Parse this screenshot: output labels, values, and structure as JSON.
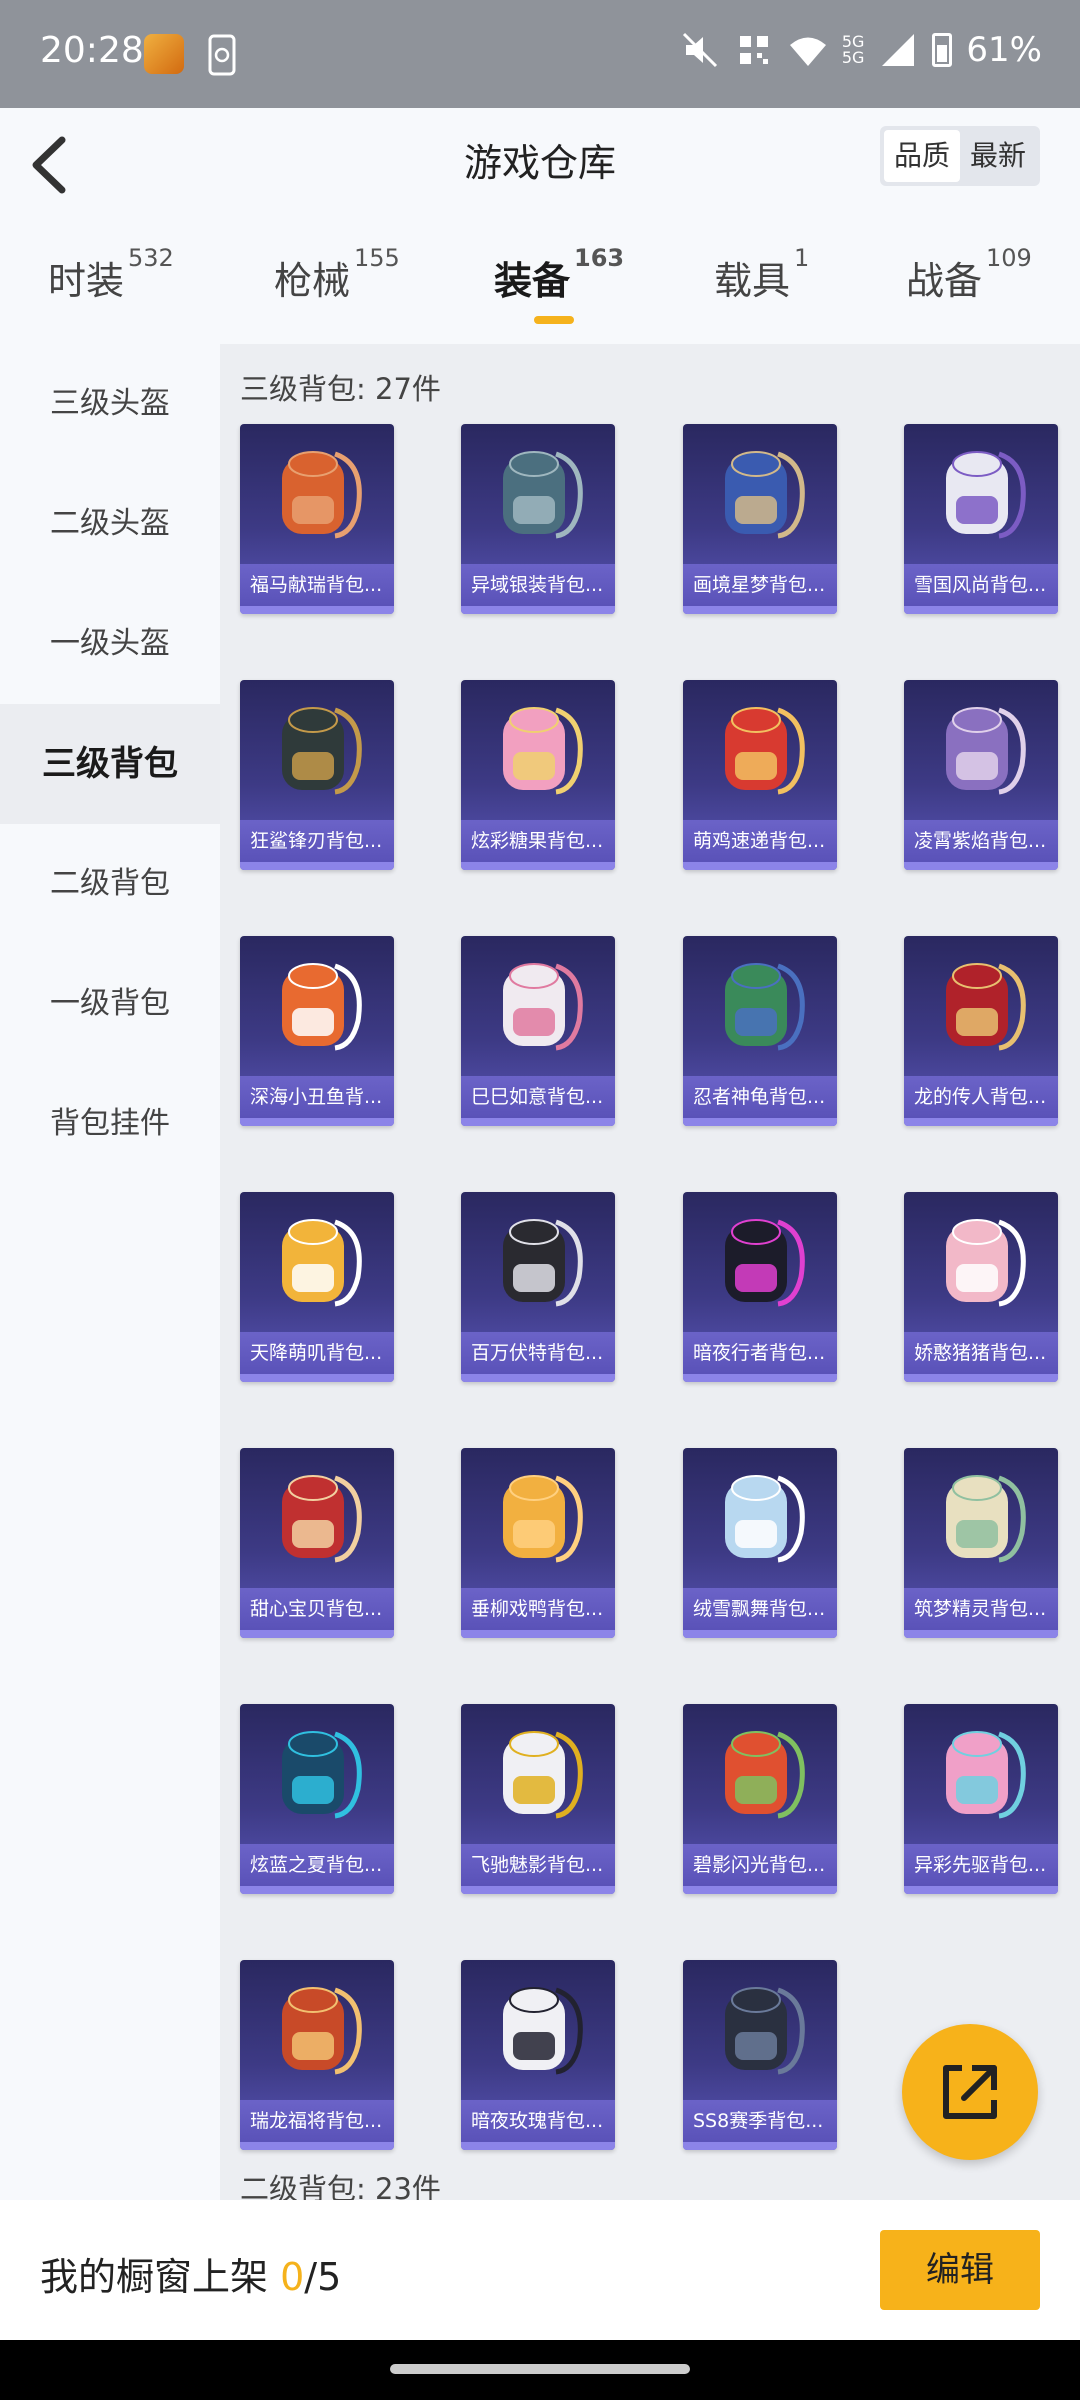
{
  "status_bar": {
    "time": "20:28",
    "battery": "61%",
    "icons": [
      "app-notification-icon",
      "phone-sync-icon",
      "mute-icon",
      "nfc-icon",
      "wifi-icon",
      "signal-5g-icon",
      "battery-icon"
    ],
    "network_label_1": "5G",
    "network_label_2": "5G"
  },
  "header": {
    "title": "游戏仓库",
    "sort_options": [
      "品质",
      "最新"
    ],
    "sort_selected": "品质"
  },
  "tabs": [
    {
      "label": "时装",
      "count": "532"
    },
    {
      "label": "枪械",
      "count": "155"
    },
    {
      "label": "装备",
      "count": "163"
    },
    {
      "label": "载具",
      "count": "1"
    },
    {
      "label": "战备",
      "count": "109"
    }
  ],
  "active_tab": "装备",
  "sidenav": [
    "三级头盔",
    "二级头盔",
    "一级头盔",
    "三级背包",
    "二级背包",
    "一级背包",
    "背包挂件"
  ],
  "active_sidenav": "三级背包",
  "section": {
    "title": "三级背包: 27件",
    "next_title": "二级背包: 23件"
  },
  "items": [
    {
      "label": "福马献瑞背包...",
      "color": "#d9622f",
      "accent": "#e8a070"
    },
    {
      "label": "异域银装背包...",
      "color": "#4b6f7f",
      "accent": "#9fb7bf"
    },
    {
      "label": "画境星梦背包...",
      "color": "#3a5bb0",
      "accent": "#d2b98a"
    },
    {
      "label": "雪国风尚背包...",
      "color": "#e8e8f2",
      "accent": "#7c5cc4"
    },
    {
      "label": "狂鲨锋刃背包...",
      "color": "#2f3a3a",
      "accent": "#c49a4a"
    },
    {
      "label": "炫彩糖果背包...",
      "color": "#f2a0c0",
      "accent": "#f0d070"
    },
    {
      "label": "萌鸡速递背包...",
      "color": "#d83a30",
      "accent": "#f2c060"
    },
    {
      "label": "凌霄紫焰背包...",
      "color": "#8a70c0",
      "accent": "#e0d0ea"
    },
    {
      "label": "深海小丑鱼背...",
      "color": "#e86a30",
      "accent": "#ffffff"
    },
    {
      "label": "巳巳如意背包...",
      "color": "#f0eaf0",
      "accent": "#e07aa0"
    },
    {
      "label": "忍者神龟背包...",
      "color": "#3a8a5a",
      "accent": "#4a70c0"
    },
    {
      "label": "龙的传人背包...",
      "color": "#b0222a",
      "accent": "#e8c070"
    },
    {
      "label": "天降萌叽背包...",
      "color": "#f2b43a",
      "accent": "#ffffff"
    },
    {
      "label": "百万伏特背包...",
      "color": "#2a2a30",
      "accent": "#e0e0e8"
    },
    {
      "label": "暗夜行者背包...",
      "color": "#1c1c2a",
      "accent": "#e040d0"
    },
    {
      "label": "娇憨猪猪背包...",
      "color": "#f2b8c8",
      "accent": "#ffffff"
    },
    {
      "label": "甜心宝贝背包...",
      "color": "#c03030",
      "accent": "#f2d0a0"
    },
    {
      "label": "垂柳戏鸭背包...",
      "color": "#f2b040",
      "accent": "#ffd080"
    },
    {
      "label": "绒雪飘舞背包...",
      "color": "#b8d8f0",
      "accent": "#ffffff"
    },
    {
      "label": "筑梦精灵背包...",
      "color": "#e8e0c0",
      "accent": "#90c0a0"
    },
    {
      "label": "炫蓝之夏背包...",
      "color": "#1a4a6a",
      "accent": "#30c0e0"
    },
    {
      "label": "飞驰魅影背包...",
      "color": "#f0f0f4",
      "accent": "#e0b020"
    },
    {
      "label": "碧影闪光背包...",
      "color": "#e05030",
      "accent": "#80c060"
    },
    {
      "label": "异彩先驱背包...",
      "color": "#f0a0c8",
      "accent": "#70d0e0"
    },
    {
      "label": "瑞龙福将背包...",
      "color": "#c84a28",
      "accent": "#f2c070"
    },
    {
      "label": "暗夜玫瑰背包...",
      "color": "#f0f0f4",
      "accent": "#222230"
    },
    {
      "label": "SS8赛季背包...",
      "color": "#2a3040",
      "accent": "#6a7a9a"
    }
  ],
  "bottom_bar": {
    "showcase_label": "我的橱窗上架",
    "showcase_current": "0",
    "showcase_total": "/5",
    "edit_label": "编辑"
  },
  "colors": {
    "accent": "#f7b21a",
    "card_bg": "#3d3a85",
    "card_label": "#6b63c8"
  }
}
